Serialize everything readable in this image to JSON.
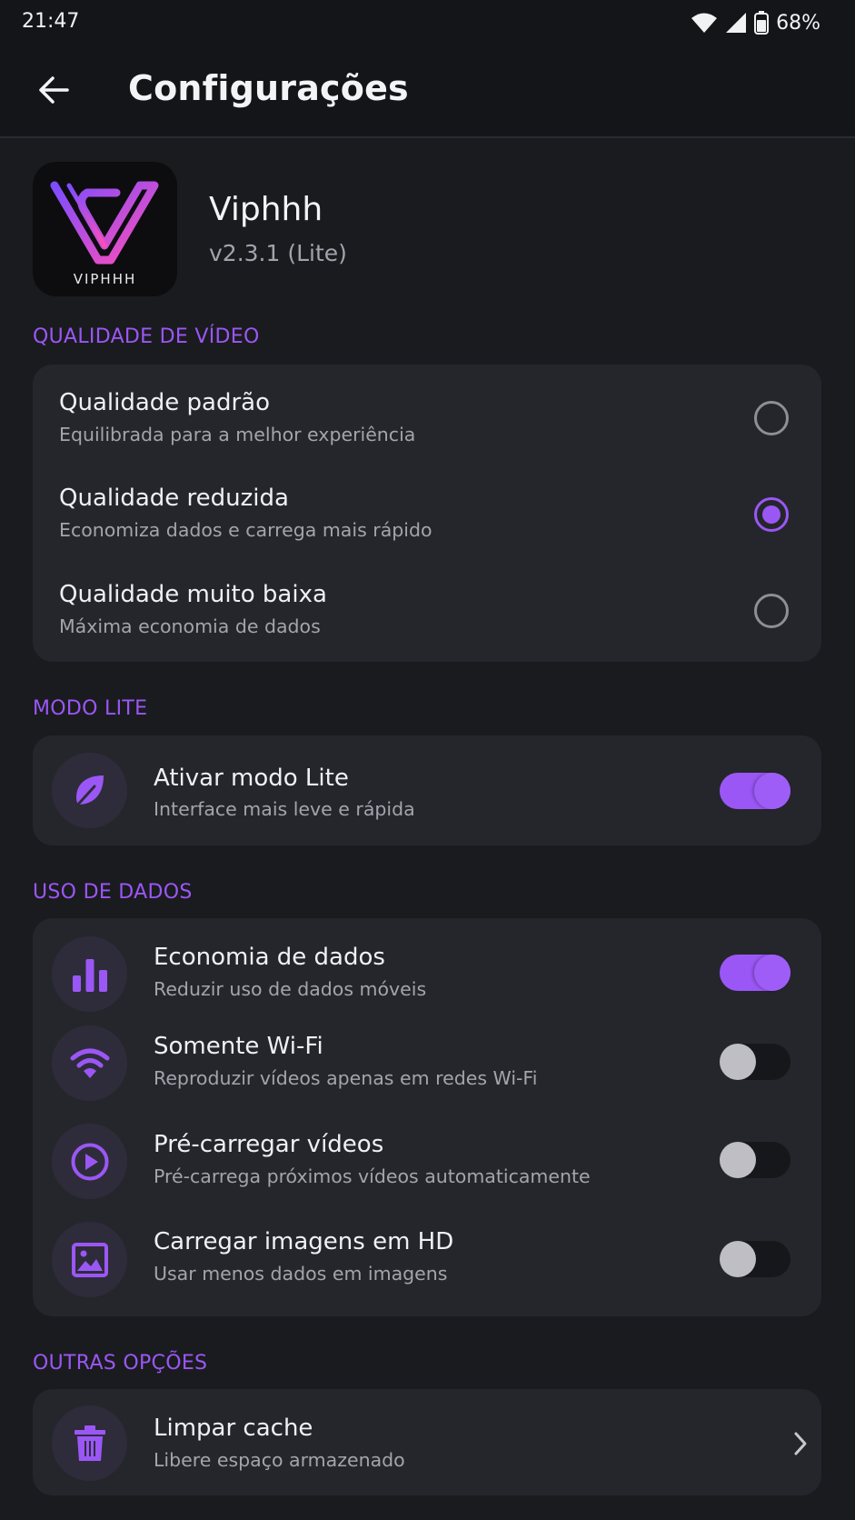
{
  "status_bar": {
    "time": "21:47",
    "battery": "68%",
    "icons": [
      "wifi-icon",
      "cell-signal-icon",
      "battery-icon"
    ]
  },
  "app_bar": {
    "title": "Configurações",
    "back_icon": "arrow-left-icon"
  },
  "app_info": {
    "name": "Viphhh",
    "version": "v2.3.1 (Lite)",
    "logo_text": "VIPHHH"
  },
  "sections": {
    "video_quality": {
      "label": "QUALIDADE DE VÍDEO",
      "options": [
        {
          "title": "Qualidade padrão",
          "subtitle": "Equilibrada para a melhor experiência",
          "selected": false
        },
        {
          "title": "Qualidade reduzida",
          "subtitle": "Economiza dados e carrega mais rápido",
          "selected": true
        },
        {
          "title": "Qualidade muito baixa",
          "subtitle": "Máxima economia de dados",
          "selected": false
        }
      ]
    },
    "lite_mode": {
      "label": "MODO LITE",
      "items": [
        {
          "title": "Ativar modo Lite",
          "subtitle": "Interface mais leve e rápida",
          "icon": "leaf-icon",
          "enabled": true
        }
      ]
    },
    "data_usage": {
      "label": "USO DE DADOS",
      "items": [
        {
          "title": "Economia de dados",
          "subtitle": "Reduzir uso de dados móveis",
          "icon": "bar-chart-icon",
          "enabled": true
        },
        {
          "title": "Somente Wi-Fi",
          "subtitle": "Reproduzir vídeos apenas em redes Wi-Fi",
          "icon": "wifi-icon",
          "enabled": false
        },
        {
          "title": "Pré-carregar vídeos",
          "subtitle": "Pré-carrega próximos vídeos automaticamente",
          "icon": "play-circle-icon",
          "enabled": false
        },
        {
          "title": "Carregar imagens em HD",
          "subtitle": "Usar menos dados em imagens",
          "icon": "image-icon",
          "enabled": false
        }
      ]
    },
    "other_options": {
      "label": "OUTRAS OPÇÕES",
      "items": [
        {
          "title": "Limpar cache",
          "subtitle": "Libere espaço armazenado",
          "icon": "trash-icon"
        }
      ]
    }
  },
  "colors": {
    "accent": "#9b57f5",
    "background": "#1a1b1f",
    "card": "#25262c",
    "bar": "#141519"
  }
}
